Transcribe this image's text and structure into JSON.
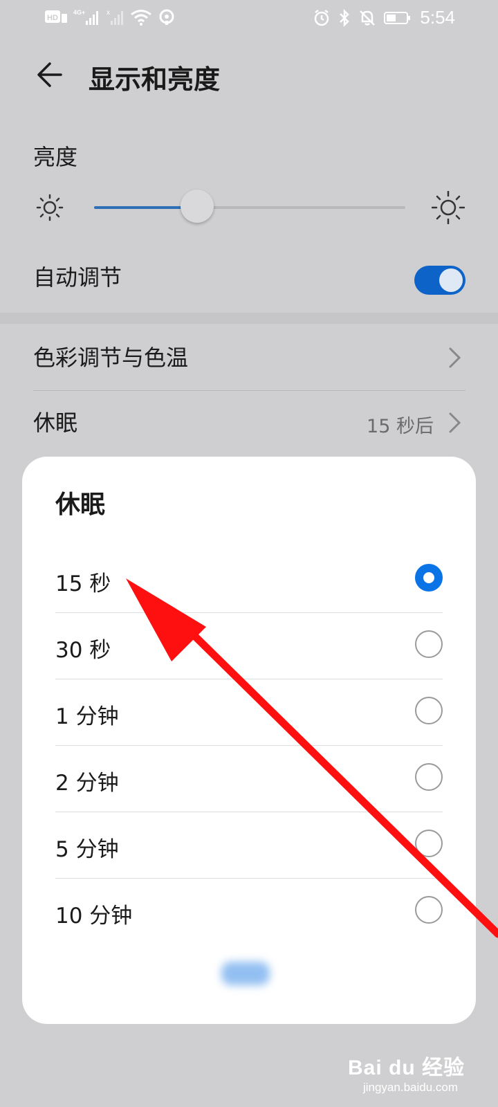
{
  "status_bar": {
    "left_icons": [
      "hd-icon",
      "signal-4g-icon",
      "signal-x-icon",
      "wifi-icon",
      "hotspot-icon"
    ],
    "right_icons": [
      "alarm-icon",
      "bluetooth-icon",
      "mute-icon",
      "battery-icon"
    ],
    "time": "5:54"
  },
  "header": {
    "title": "显示和亮度"
  },
  "brightness": {
    "label": "亮度",
    "level_fraction": 0.33
  },
  "auto_adjust": {
    "label": "自动调节",
    "on": true
  },
  "color_temp": {
    "label": "色彩调节与色温"
  },
  "sleep": {
    "label": "休眠",
    "value": "15 秒后"
  },
  "sleep_dialog": {
    "title": "休眠",
    "options": [
      {
        "label": "15 秒",
        "selected": true
      },
      {
        "label": "30 秒",
        "selected": false
      },
      {
        "label": "1 分钟",
        "selected": false
      },
      {
        "label": "2 分钟",
        "selected": false
      },
      {
        "label": "5 分钟",
        "selected": false
      },
      {
        "label": "10 分钟",
        "selected": false
      }
    ]
  },
  "colors": {
    "accent": "#0a74e6",
    "arrow": "#ff1010",
    "toggle": "#0d63c7"
  },
  "watermark": {
    "main": "Bai du 经验",
    "sub": "jingyan.baidu.com"
  }
}
